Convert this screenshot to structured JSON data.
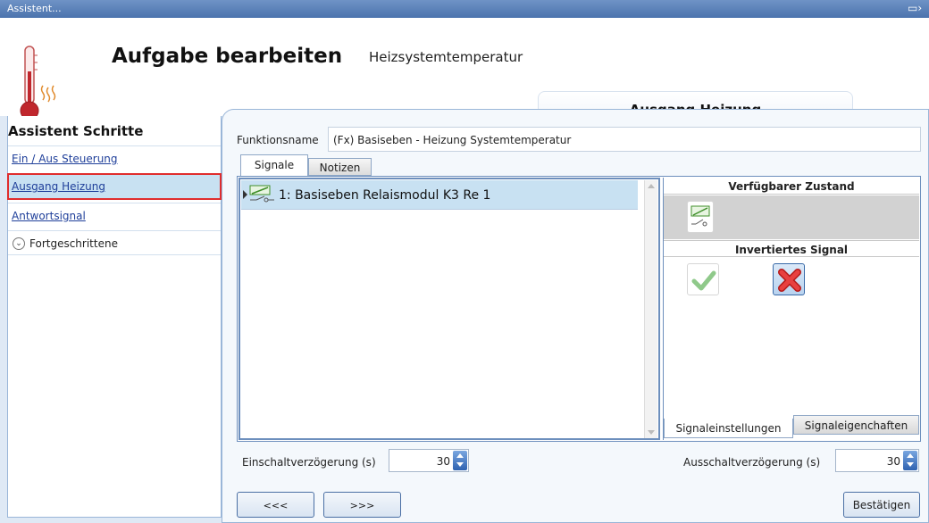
{
  "window": {
    "title": "Assistent..."
  },
  "header": {
    "title": "Aufgabe bearbeiten",
    "subtitle": "Heizsystemtemperatur",
    "current_step": "Ausgang Heizung"
  },
  "sidebar": {
    "heading": "Assistent Schritte",
    "items": [
      {
        "label": "Ein / Aus Steuerung"
      },
      {
        "label": "Ausgang Heizung",
        "selected": true
      },
      {
        "label": "Antwortsignal"
      }
    ],
    "advanced_label": "Fortgeschrittene"
  },
  "form": {
    "function_name_label": "Funktionsname",
    "function_name_value": "(Fx) Basiseben - Heizung Systemtemperatur",
    "tabs": [
      {
        "label": "Signale",
        "active": true
      },
      {
        "label": "Notizen",
        "active": false
      }
    ],
    "signals": [
      {
        "label": "1: Basiseben Relaismodul K3 Re 1",
        "selected": true
      }
    ],
    "properties": {
      "available_state_heading": "Verfügbarer Zustand",
      "inverted_signal_heading": "Invertiertes Signal",
      "inverted_selected": "no"
    },
    "property_tabs": [
      {
        "label": "Signaleinstellungen",
        "active": true
      },
      {
        "label": "Signaleigenchaften",
        "active": false
      }
    ],
    "on_delay_label": "Einschaltverzögerung (s)",
    "on_delay_value": "30",
    "off_delay_label": "Ausschaltverzögerung (s)",
    "off_delay_value": "30"
  },
  "navigation": {
    "back_label": "<<<",
    "next_label": ">>>",
    "confirm_label": "Bestätigen"
  },
  "colors": {
    "accent_blue": "#4b73ad",
    "selection_blue": "#c8e1f2",
    "highlight_red": "#e02d2d"
  }
}
